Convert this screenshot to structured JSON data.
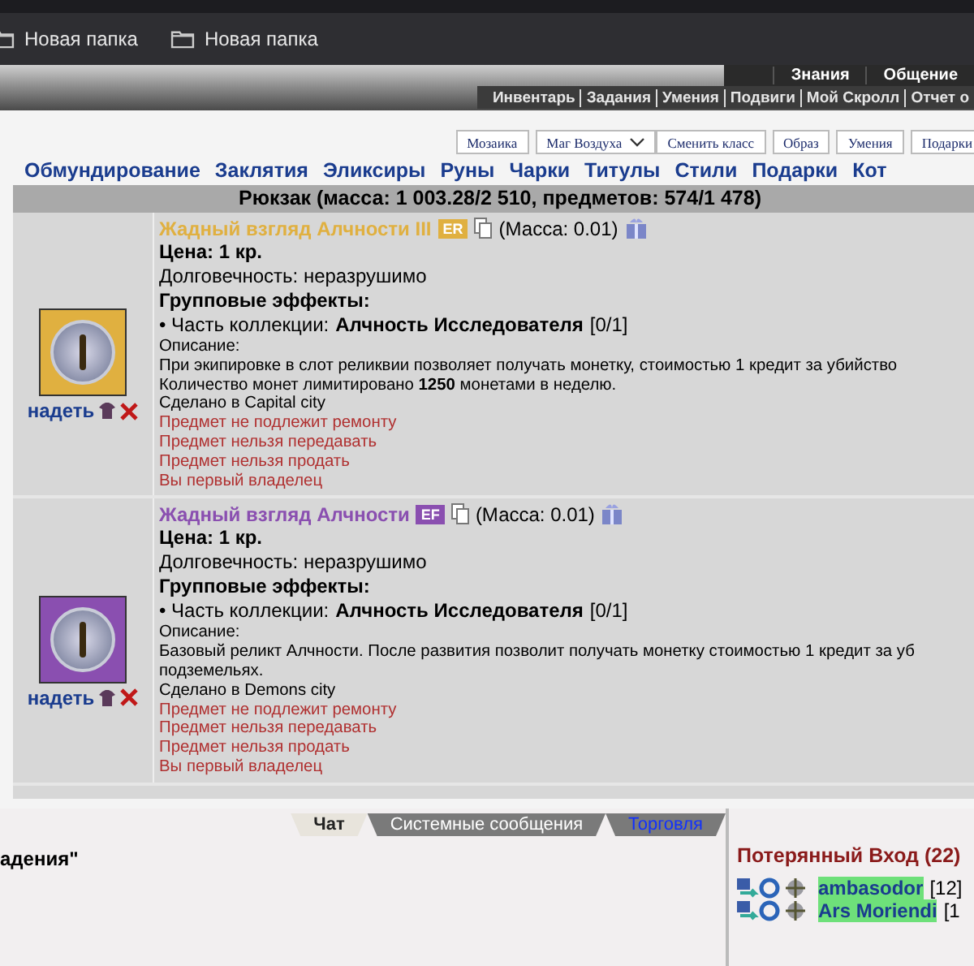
{
  "bookmarks": [
    {
      "label": "Новая папка"
    },
    {
      "label": "Новая папка"
    }
  ],
  "header": {
    "top_links": [
      "Знания",
      "Общение"
    ],
    "sub_links": [
      "Инвентарь",
      "Задания",
      "Умения",
      "Подвиги",
      "Мой Скролл",
      "Отчет о"
    ]
  },
  "toolbar": [
    {
      "kind": "button",
      "label": "Мозаика"
    },
    {
      "kind": "select",
      "label": "Маг Воздуха"
    },
    {
      "kind": "button",
      "label": "Сменить класс"
    },
    {
      "kind": "button",
      "label": "Образ"
    },
    {
      "kind": "button",
      "label": "Умения"
    },
    {
      "kind": "button",
      "label": "Подарки"
    }
  ],
  "categories": [
    "Обмундирование",
    "Заклятия",
    "Эликсиры",
    "Руны",
    "Чарки",
    "Титулы",
    "Стили",
    "Подарки",
    "Кот"
  ],
  "backpack_title": "Рюкзак (масса: 1 003.28/2 510, предметов: 574/1 478)",
  "items": [
    {
      "name": "Жадный взгляд Алчности III",
      "color": "#e0b040",
      "badge": "ER",
      "mass": "(Масса: 0.01)",
      "price": "Цена: 1 кр.",
      "durability": "Долговечность: неразрушимо",
      "effects_title": "Групповые эффекты:",
      "collection_label": "• Часть коллекции:",
      "collection": "Алчность Исследователя",
      "collection_count": "[0/1]",
      "description_label": "Описание:",
      "description": [
        "При экипировке в слот реликвии позволяет получать монетку, стоимостью 1 кредит за убийство",
        "Количество монет лимитировано **1250** монетами в неделю."
      ],
      "made_in": "Сделано в Capital city",
      "warnings": [
        "Предмет не подлежит ремонту",
        "Предмет нельзя передавать",
        "Предмет нельзя продать",
        "Вы первый владелец"
      ],
      "action": "надеть"
    },
    {
      "name": "Жадный взгляд Алчности",
      "color": "#8a4fb0",
      "badge": "EF",
      "mass": "(Масса: 0.01)",
      "price": "Цена: 1 кр.",
      "durability": "Долговечность: неразрушимо",
      "effects_title": "Групповые эффекты:",
      "collection_label": "• Часть коллекции:",
      "collection": "Алчность Исследователя",
      "collection_count": "[0/1]",
      "description_label": "Описание:",
      "description": [
        "Базовый реликт Алчности. После развития позволит получать монетку стоимостью 1 кредит за уб",
        "подземельях."
      ],
      "made_in": "Сделано в Demons city",
      "warnings": [
        "Предмет не подлежит ремонту",
        "Предмет нельзя передавать",
        "Предмет нельзя продать",
        "Вы первый владелец"
      ],
      "action": "надеть"
    }
  ],
  "chat": {
    "tabs": [
      {
        "label": "Чат",
        "selected": true
      },
      {
        "label": "Системные сообщения",
        "selected": false
      },
      {
        "label": "Торговля",
        "selected": false
      }
    ],
    "message": "адения\""
  },
  "online": {
    "title": "Потерянный Вход (22)",
    "users": [
      {
        "name": "ambasodor",
        "level": "[12]"
      },
      {
        "name": "Ars Moriendi",
        "level": "[1"
      }
    ]
  }
}
